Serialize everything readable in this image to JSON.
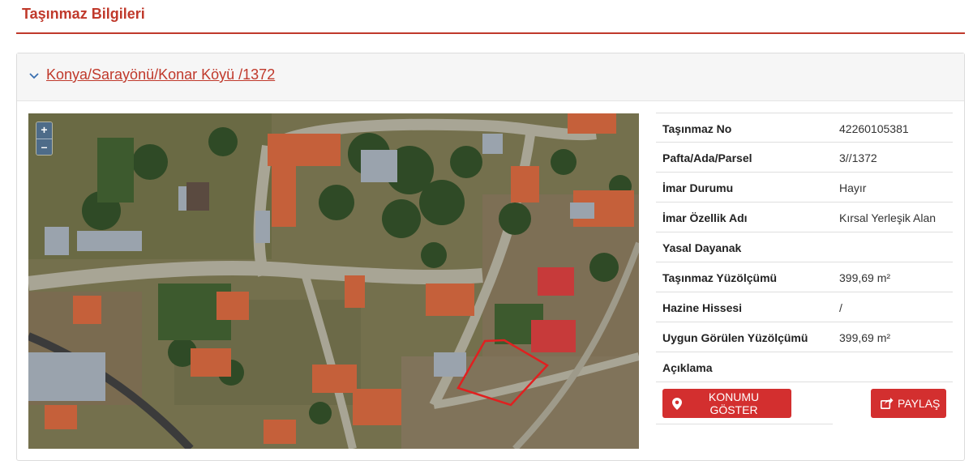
{
  "page": {
    "title": "Taşınmaz Bilgileri"
  },
  "parcel": {
    "location_link": "Konya/Sarayönü/Konar Köyü /1372",
    "accent": "#c0392b"
  },
  "map": {
    "zoom_in": "+",
    "zoom_out": "–"
  },
  "details": [
    {
      "label": "Taşınmaz No",
      "value": "42260105381"
    },
    {
      "label": "Pafta/Ada/Parsel",
      "value": "3//1372"
    },
    {
      "label": "İmar Durumu",
      "value": "Hayır"
    },
    {
      "label": "İmar Özellik Adı",
      "value": "Kırsal Yerleşik Alan"
    },
    {
      "label": "Yasal Dayanak",
      "value": ""
    },
    {
      "label": "Taşınmaz Yüzölçümü",
      "value": "399,69 m²"
    },
    {
      "label": "Hazine Hissesi",
      "value": "/"
    },
    {
      "label": "Uygun Görülen Yüzölçümü",
      "value": "399,69 m²"
    },
    {
      "label": "Açıklama",
      "value": ""
    }
  ],
  "actions": {
    "show_location": "KONUMU GÖSTER",
    "share": "PAYLAŞ"
  }
}
